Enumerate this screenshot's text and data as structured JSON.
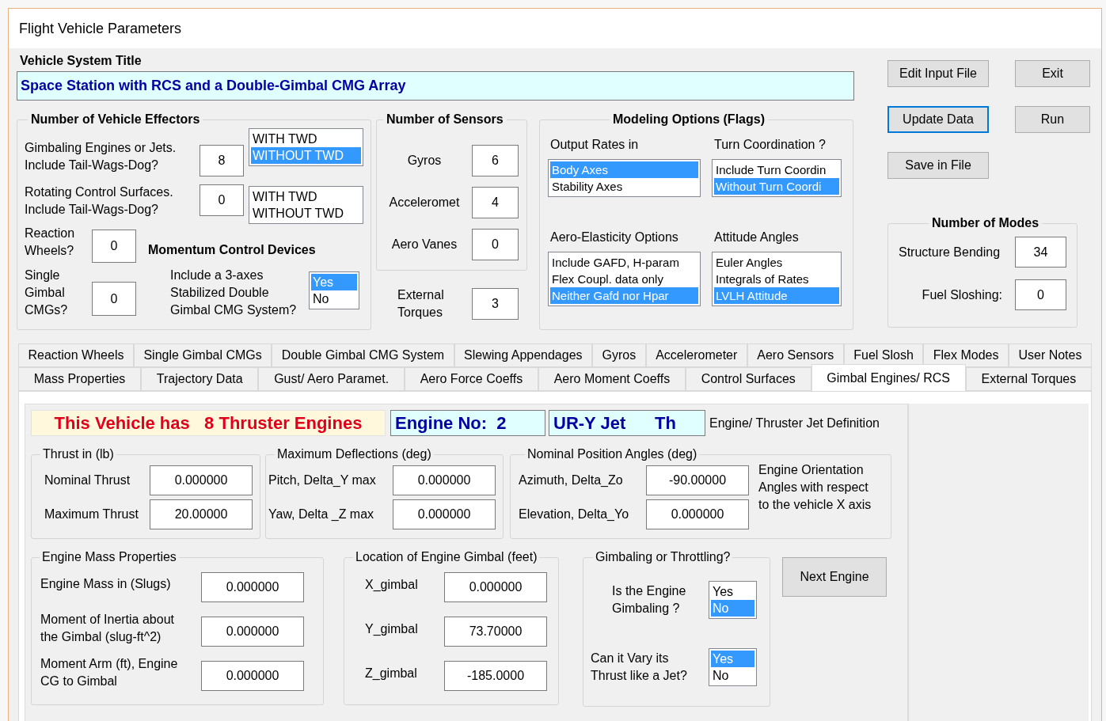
{
  "window": {
    "title": "Flight Vehicle Parameters"
  },
  "vehicle_title": {
    "label": "Vehicle System Title",
    "value": "Space Station with RCS and a Double-Gimbal CMG Array"
  },
  "effectors": {
    "title": "Number of Vehicle Effectors",
    "rows": [
      {
        "label": "Gimbaling Engines or Jets.\nInclude Tail-Wags-Dog?",
        "value": "8",
        "options": [
          {
            "label": "WITH TWD",
            "selected": false
          },
          {
            "label": "WITHOUT TWD",
            "selected": true
          }
        ]
      },
      {
        "label": "Rotating Control Surfaces.\nInclude Tail-Wags-Dog?",
        "value": "0",
        "options": [
          {
            "label": "WITH TWD",
            "selected": false
          },
          {
            "label": "WITHOUT TWD",
            "selected": false
          }
        ]
      }
    ],
    "reaction_wheels": {
      "label": "Reaction\nWheels?",
      "value": "0"
    },
    "momentum_title": "Momentum Control Devices",
    "single_gimbal": {
      "label": "Single\nGimbal\nCMGs?",
      "value": "0"
    },
    "double_gimbal": {
      "label": "Include a 3-axes\nStabilized Double\nGimbal CMG System?",
      "options": [
        {
          "label": "Yes",
          "selected": true
        },
        {
          "label": "No",
          "selected": false
        }
      ]
    }
  },
  "sensors": {
    "title": "Number of Sensors",
    "items": [
      {
        "label": "Gyros",
        "value": "6"
      },
      {
        "label": "Acceleromet",
        "value": "4"
      },
      {
        "label": "Aero Vanes",
        "value": "0"
      }
    ],
    "external_torques": {
      "label": "External\nTorques",
      "value": "3"
    }
  },
  "modeling": {
    "title": "Modeling Options (Flags)",
    "lists": [
      {
        "label": "Output Rates in",
        "options": [
          {
            "label": "Body Axes",
            "selected": true
          },
          {
            "label": "Stability Axes",
            "selected": false
          }
        ]
      },
      {
        "label": "Turn Coordination ?",
        "options": [
          {
            "label": "Include Turn Coordin",
            "selected": false
          },
          {
            "label": "Without Turn Coordi",
            "selected": true
          }
        ]
      },
      {
        "label": "Aero-Elasticity Options",
        "options": [
          {
            "label": "Include GAFD, H-param",
            "selected": false
          },
          {
            "label": "Flex Coupl. data only",
            "selected": false
          },
          {
            "label": "Neither Gafd nor Hpar",
            "selected": true
          }
        ]
      },
      {
        "label": "Attitude Angles",
        "options": [
          {
            "label": "Euler Angles",
            "selected": false
          },
          {
            "label": "Integrals of Rates",
            "selected": false
          },
          {
            "label": "LVLH Attitude",
            "selected": true
          }
        ]
      }
    ]
  },
  "buttons": [
    {
      "label": "Edit Input File",
      "focused": false
    },
    {
      "label": "Exit",
      "focused": false
    },
    {
      "label": "Update Data",
      "focused": true
    },
    {
      "label": "Run",
      "focused": false
    },
    {
      "label": "Save in File",
      "focused": false
    }
  ],
  "modes": {
    "title": "Number of Modes",
    "items": [
      {
        "label": "Structure Bending",
        "value": "34"
      },
      {
        "label": "Fuel Sloshing:",
        "value": "0"
      }
    ]
  },
  "tabs": {
    "rows": [
      {
        "tabs": [
          {
            "label": "Reaction Wheels",
            "selected": false
          },
          {
            "label": "Single Gimbal CMGs",
            "selected": false
          },
          {
            "label": "Double Gimbal CMG System",
            "selected": false
          },
          {
            "label": "Slewing Appendages",
            "selected": false
          },
          {
            "label": "Gyros",
            "selected": false
          },
          {
            "label": "Accelerometer",
            "selected": false
          },
          {
            "label": "Aero Sensors",
            "selected": false
          },
          {
            "label": "Fuel Slosh",
            "selected": false
          },
          {
            "label": "Flex Modes",
            "selected": false
          },
          {
            "label": "User Notes",
            "selected": false
          }
        ]
      },
      {
        "tabs": [
          {
            "label": "Mass Properties",
            "selected": false
          },
          {
            "label": "Trajectory Data",
            "selected": false
          },
          {
            "label": "Gust/ Aero Paramet.",
            "selected": false
          },
          {
            "label": "Aero Force Coeffs",
            "selected": false
          },
          {
            "label": "Aero Moment Coeffs",
            "selected": false
          },
          {
            "label": "Control Surfaces",
            "selected": false
          },
          {
            "label": "Gimbal Engines/ RCS",
            "selected": true
          },
          {
            "label": "External Torques",
            "selected": false
          }
        ]
      }
    ]
  },
  "engine": {
    "banner": "This Vehicle has   8 Thruster Engines",
    "engine_no": "Engine No:  2",
    "jet_name": "UR-Y Jet      Th",
    "definition_label": "Engine/ Thruster Jet Definition",
    "thrust": {
      "title": "Thrust in (lb)",
      "fields": [
        {
          "label": "Nominal Thrust",
          "value": "0.000000"
        },
        {
          "label": "Maximum Thrust",
          "value": "20.00000"
        }
      ]
    },
    "deflections": {
      "title": "Maximum Deflections (deg)",
      "fields": [
        {
          "label": "Pitch, Delta_Y max",
          "value": "0.000000"
        },
        {
          "label": "Yaw, Delta _Z max",
          "value": "0.000000"
        }
      ]
    },
    "position": {
      "title": "Nominal Position Angles (deg)",
      "fields": [
        {
          "label": "Azimuth, Delta_Zo",
          "value": "-90.00000"
        },
        {
          "label": "Elevation, Delta_Yo",
          "value": "0.000000"
        }
      ],
      "note": "Engine Orientation\nAngles with respect\nto the vehicle  X axis"
    },
    "mass": {
      "title": "Engine Mass Properties",
      "fields": [
        {
          "label": "Engine Mass in (Slugs)",
          "value": "0.000000"
        },
        {
          "label": "Moment of Inertia about\nthe Gimbal (slug-ft^2)",
          "value": "0.000000"
        },
        {
          "label": "Moment Arm (ft), Engine\nCG to Gimbal",
          "value": "0.000000"
        }
      ]
    },
    "location": {
      "title": "Location of Engine Gimbal (feet)",
      "fields": [
        {
          "label": "X_gimbal",
          "value": "0.000000"
        },
        {
          "label": "Y_gimbal",
          "value": "73.70000"
        },
        {
          "label": "Z_gimbal",
          "value": "-185.0000"
        }
      ]
    },
    "gimbaling": {
      "title": "Gimbaling or Throttling?",
      "questions": [
        {
          "label": "Is the Engine\nGimbaling ?",
          "options": [
            {
              "label": "Yes",
              "selected": false
            },
            {
              "label": "No",
              "selected": true
            }
          ]
        },
        {
          "label": "Can it Vary its\nThrust like a Jet?",
          "options": [
            {
              "label": "Yes",
              "selected": true
            },
            {
              "label": "No",
              "selected": false
            }
          ]
        }
      ]
    },
    "next_button": "Next Engine"
  }
}
